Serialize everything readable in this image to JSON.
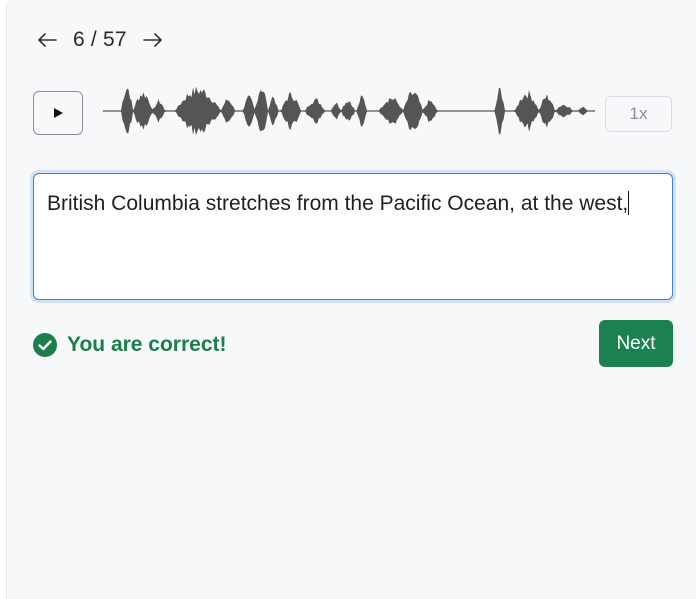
{
  "navigation": {
    "counter": "6 / 57",
    "prev_icon": "arrow-left-icon",
    "next_icon": "arrow-right-icon"
  },
  "audio": {
    "play_icon": "play-icon",
    "speed_label": "1x"
  },
  "answer": {
    "value": "British Columbia stretches from the Pacific Ocean, at the west,"
  },
  "feedback": {
    "icon": "check-circle-icon",
    "message": "You are correct!"
  },
  "actions": {
    "next_label": "Next"
  },
  "colors": {
    "success": "#1b7f4c",
    "next_button": "#1b8150",
    "focus_border": "#3f82c8",
    "waveform": "#555555"
  }
}
